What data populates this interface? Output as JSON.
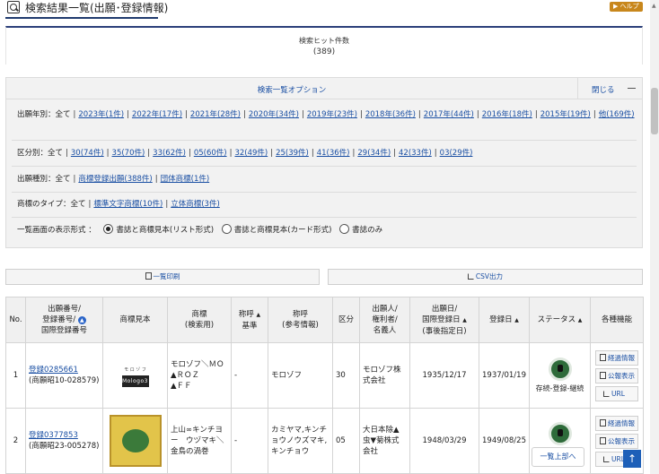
{
  "header": {
    "title": "検索結果一覧(出願･登録情報)",
    "help": "▶ ヘルプ"
  },
  "hits": {
    "label": "検索ヒット件数",
    "count": "(389)"
  },
  "options": {
    "title": "検索一覧オプション",
    "close": "閉じる",
    "year_label": "出願年別：全て",
    "years": [
      "2023年(1件)",
      "2022年(17件)",
      "2021年(28件)",
      "2020年(34件)",
      "2019年(23件)",
      "2018年(36件)",
      "2017年(44件)",
      "2016年(18件)",
      "2015年(19件)",
      "他(169件)"
    ],
    "class_label": "区分別：全て",
    "classes": [
      "30(74件)",
      "35(70件)",
      "33(62件)",
      "05(60件)",
      "32(49件)",
      "25(39件)",
      "41(36件)",
      "29(34件)",
      "42(33件)",
      "03(29件)"
    ],
    "kind_label": "出願種別：全て",
    "kinds": [
      "商標登録出願(388件)",
      "団体商標(1件)"
    ],
    "type_label": "商標のタイプ：全て",
    "types": [
      "標準文字商標(10件)",
      "立体商標(3件)"
    ],
    "display_label": "一覧画面の表示形式 ：",
    "display_options": [
      "書誌と商標見本(リスト形式)",
      "書誌と商標見本(カード形式)",
      "書誌のみ"
    ]
  },
  "buttons": {
    "print": "一覧印刷",
    "csv": "CSV出力"
  },
  "table": {
    "headers": {
      "no": "No.",
      "number": [
        "出願番号/",
        "登録番号/",
        "国際登録番号"
      ],
      "sample": "商標見本",
      "mark": [
        "商標",
        "(検索用)"
      ],
      "call": [
        "称呼",
        "基準"
      ],
      "call_ref": [
        "称呼",
        "(参考情報)"
      ],
      "class": "区分",
      "applicant": [
        "出願人/",
        "権利者/",
        "名義人"
      ],
      "filing": [
        "出願日/",
        "国際登録日",
        "(事後指定日)"
      ],
      "reg_date": "登録日",
      "status": "ステータス",
      "functions": "各種機能"
    },
    "rows": [
      {
        "no": "1",
        "reg": "登録0285661",
        "app": "(商願昭10-028579)",
        "logo_text": "Mologo3",
        "logo_small": "モ ロ ゾ フ",
        "mark": "モロゾフ＼ＭＯ▲ＲＯＺ▲Ｏ▲ＦＦ",
        "mark_display": "モロゾフ＼ＭＯ\n▲ＲＯＺ\n▲ＦＦ",
        "call": "-",
        "call_ref": "モロゾフ",
        "class": "30",
        "applicant": "モロゾフ株式会社",
        "filing": "1935/12/17",
        "reg_date": "1937/01/19",
        "status": "存続-登録-継続"
      },
      {
        "no": "2",
        "reg": "登録0377853",
        "app": "(商願昭23-005278)",
        "mark": "上山∞キンチヨー　ウヅマキ＼金鳥の渦巻",
        "call": "-",
        "call_ref": "カミヤマ,キンチョウノウズマキ,キンチョウ",
        "class": "05",
        "applicant": "大日本除▲虫▼菊株式会社",
        "filing": "1948/03/29",
        "reg_date": "1949/08/25",
        "status": ""
      }
    ],
    "func_labels": [
      "経過情報",
      "公報表示",
      "URL"
    ]
  },
  "back_to_top": "一覧上部へ"
}
